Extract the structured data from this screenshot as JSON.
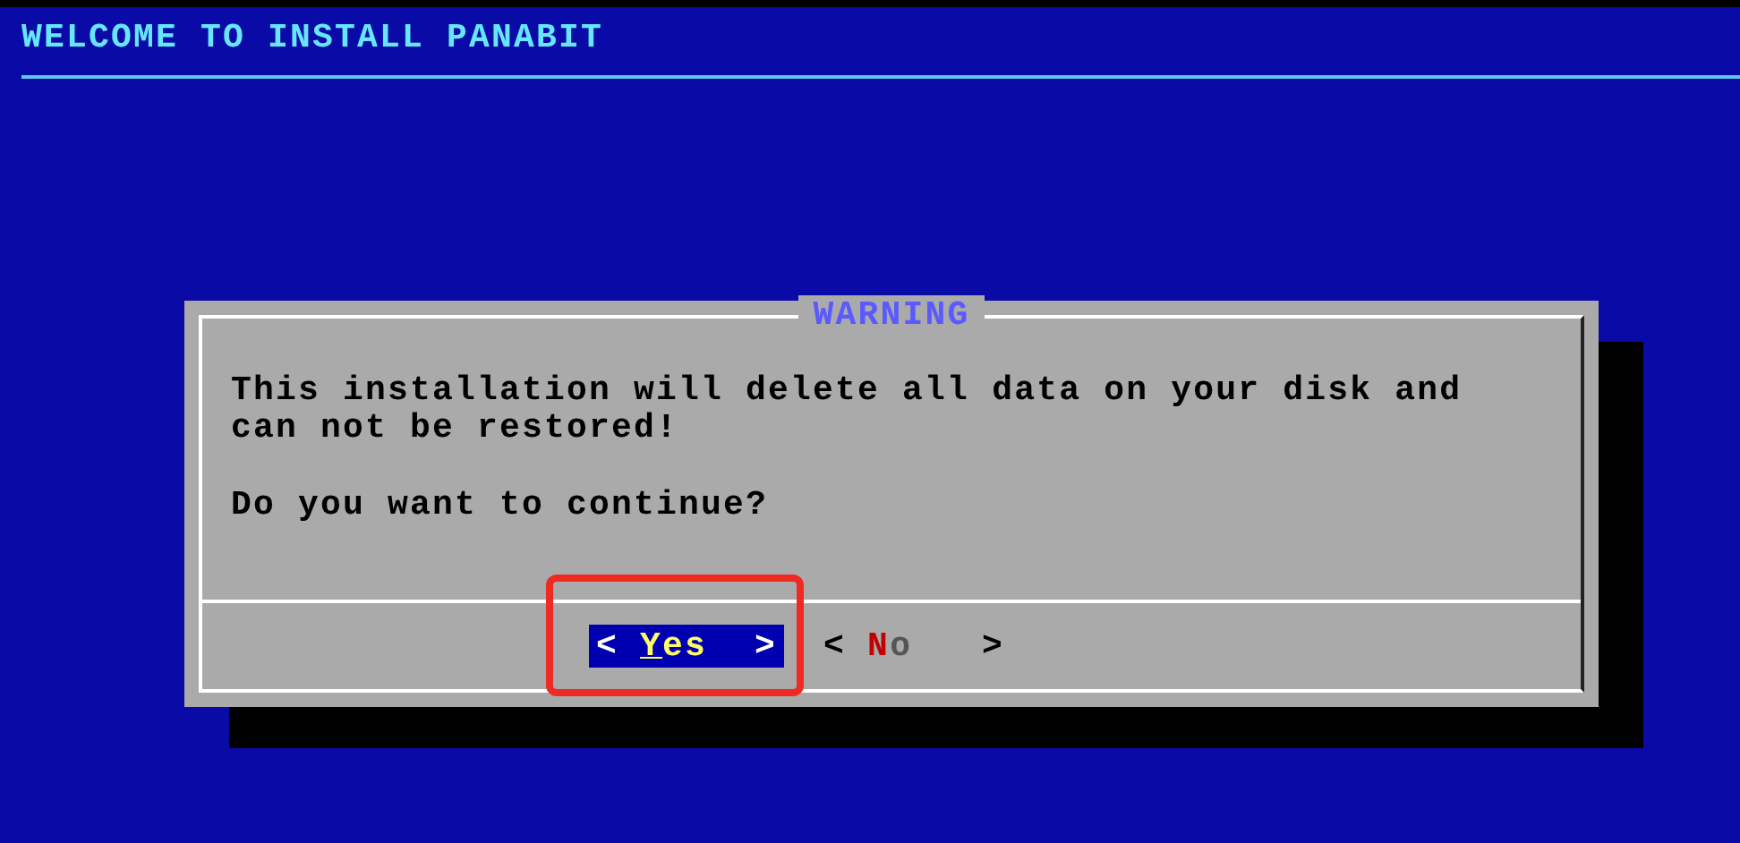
{
  "header": {
    "title": "WELCOME TO INSTALL PANABIT"
  },
  "dialog": {
    "title": "WARNING",
    "paragraphs": [
      [
        "This installation will delete all data on your disk and",
        "can not be restored!"
      ],
      [
        "Do you want to continue?"
      ]
    ],
    "buttons": [
      {
        "open": "<",
        "hotkey": "Y",
        "text": "es",
        "close": ">",
        "selected": true
      },
      {
        "open": "<",
        "hotkey": "N",
        "text": "o",
        "close": ">",
        "selected": false
      }
    ]
  }
}
